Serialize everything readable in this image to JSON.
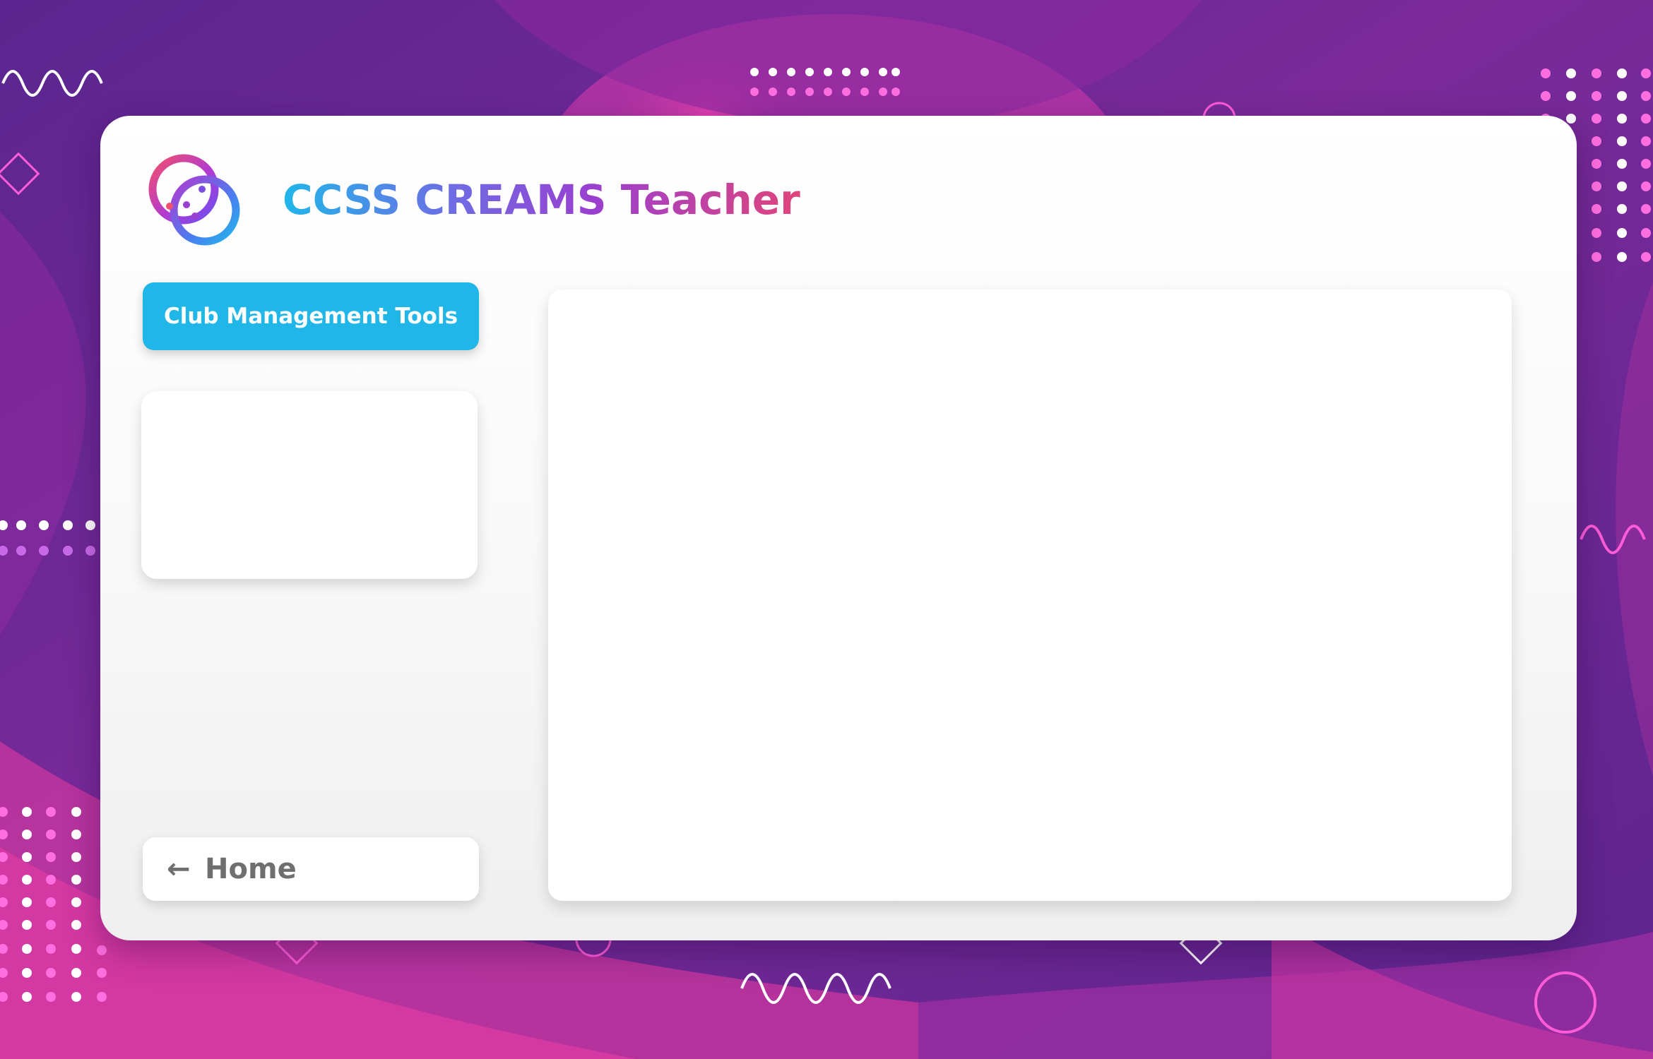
{
  "app": {
    "title": "CCSS CREAMS Teacher"
  },
  "sidebar": {
    "club_tools_label": "Club Management Tools",
    "home_label": "Home",
    "home_icon": "arrow-left-icon"
  },
  "logo": {
    "icon": "ccss-logo-icon"
  },
  "colors": {
    "accent_blue": "#20b6e8",
    "title_gradient_start": "#1fb6ea",
    "title_gradient_mid": "#9a3fd0",
    "title_gradient_end": "#e0457a",
    "background_purple": "#6a2590",
    "background_magenta": "#c0309a"
  }
}
